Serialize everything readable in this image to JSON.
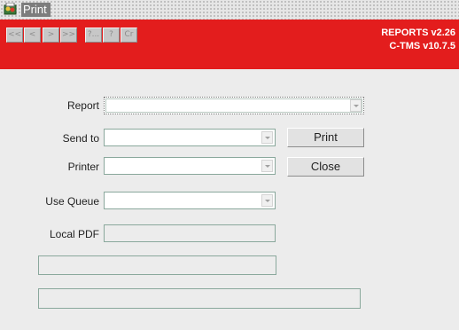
{
  "window": {
    "title": "Print"
  },
  "toolbar": {
    "buttons": [
      {
        "glyph": "<<",
        "icon": "first-record-icon"
      },
      {
        "glyph": "<",
        "icon": "previous-record-icon"
      },
      {
        "glyph": ">",
        "icon": "next-record-icon"
      },
      {
        "glyph": ">>",
        "icon": "last-record-icon"
      },
      {
        "glyph": "?...",
        "icon": "list-values-icon"
      },
      {
        "glyph": "?",
        "icon": "help-icon"
      },
      {
        "glyph": "Cr",
        "icon": "exit-icon"
      }
    ],
    "version_line1": "REPORTS v2.26",
    "version_line2": "C-TMS v10.7.5"
  },
  "form": {
    "report_label": "Report",
    "report_value": "",
    "send_to_label": "Send to",
    "send_to_value": "",
    "printer_label": "Printer",
    "printer_value": "",
    "use_queue_label": "Use Queue",
    "use_queue_value": "",
    "local_pdf_label": "Local PDF",
    "local_pdf_value": "",
    "status_1": "",
    "status_2": ""
  },
  "buttons": {
    "print_label": "Print",
    "close_label": "Close"
  },
  "colors": {
    "toolbar_bg": "#e31d1d",
    "window_bg": "#ececec",
    "field_border": "#8aa89c"
  }
}
